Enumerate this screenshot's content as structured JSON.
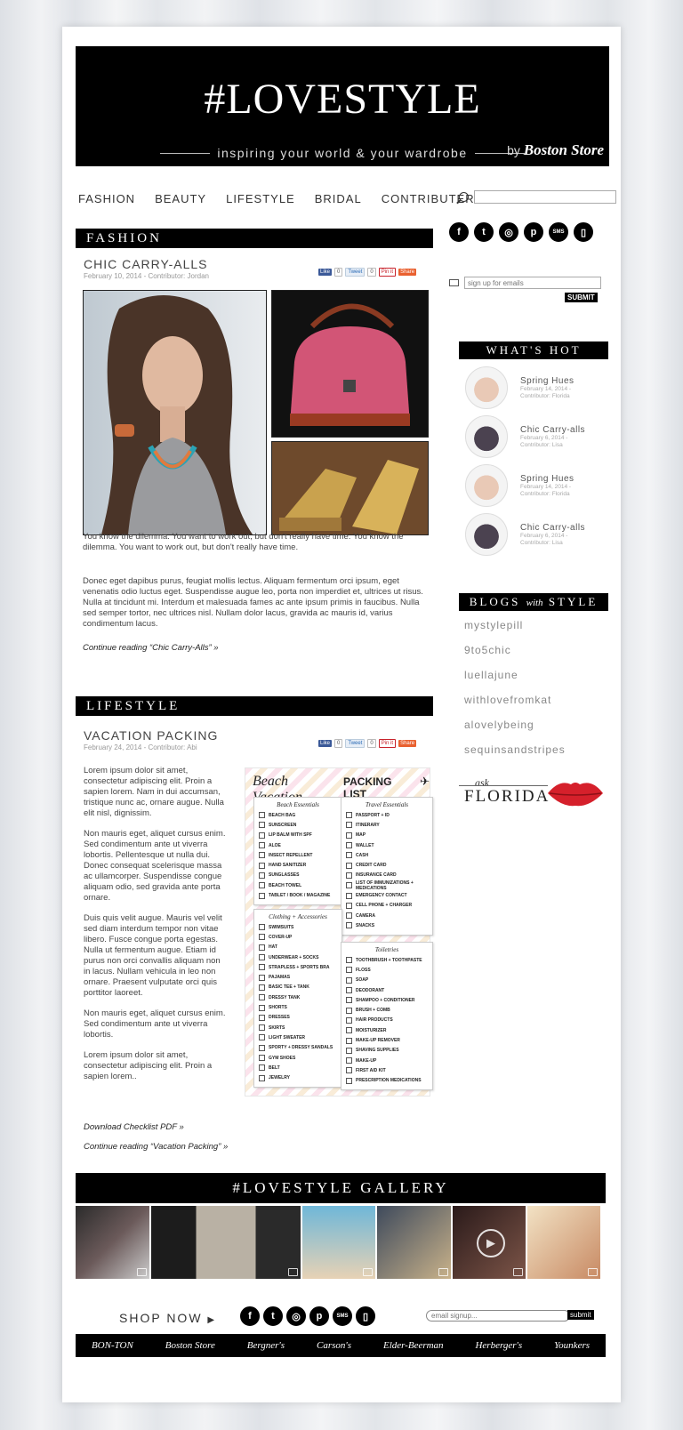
{
  "header": {
    "title": "#LOVESTYLE",
    "tagline": "inspiring your world & your wardrobe",
    "by": "by",
    "brand": "Boston Store"
  },
  "nav": {
    "items": [
      "FASHION",
      "BEAUTY",
      "LIFESTYLE",
      "BRIDAL",
      "CONTRIBUTERS"
    ],
    "search_placeholder": ""
  },
  "fashion_section": {
    "heading": "FASHION",
    "post": {
      "title": "CHIC CARRY-ALLS",
      "meta": "February 10, 2014 - Contributor: Jordan",
      "paragraph1": "You know the dilemma. You want to work out, but don't really have time. You know the dilemma. You want to work out, but don't really have time.",
      "paragraph2": "Donec eget dapibus purus, feugiat mollis lectus. Aliquam fermentum orci ipsum, eget venenatis odio luctus eget. Suspendisse augue leo, porta non imperdiet et, ultrices ut risus. Nulla at tincidunt mi. Interdum et malesuada fames ac ante ipsum primis in faucibus. Nulla sed semper tortor, nec ultrices nisl. Nullam dolor lacus, gravida ac mauris id, varius condimentum lacus.",
      "continue": "Continue reading “Chic Carry-Alls” »"
    }
  },
  "share": {
    "like": "Like",
    "like_count": "0",
    "tweet": "Tweet",
    "tweet_count": "0",
    "pin": "Pin it",
    "share": "Share"
  },
  "lifestyle_section": {
    "heading": "LIFESTYLE",
    "post": {
      "title": "VACATION PACKING",
      "meta": "February 24, 2014 - Contributor: Abi",
      "paragraphs": [
        "Lorem ipsum dolor sit amet, consectetur adipiscing elit. Proin a sapien lorem. Nam in dui accumsan, tristique nunc ac, ornare augue. Nulla elit nisl, dignissim.",
        "Non mauris eget, aliquet cursus enim. Sed condimentum ante ut viverra lobortis. Pellentesque ut nulla dui. Donec consequat scelerisque massa ac ullamcorper. Suspendisse congue aliquam odio, sed gravida ante porta ornare.",
        "Duis quis velit augue. Mauris vel velit sed diam interdum tempor non vitae libero. Fusce congue porta egestas. Nulla ut fermentum augue. Etiam id purus non orci convallis aliquam non in lacus. Nullam vehicula in leo non ornare. Praesent vulputate orci quis porttitor laoreet.",
        "Non mauris eget, aliquet cursus enim. Sed condimentum ante ut viverra lobortis.",
        "Lorem ipsum dolor sit amet, consectetur adipiscing elit. Proin a sapien lorem.."
      ],
      "download": "Download Checklist PDF »",
      "continue": "Continue reading “Vacation Packing” »"
    },
    "checklist": {
      "title_script": "Beach Vacation",
      "title_bold": "PACKING LIST",
      "groups": [
        {
          "name": "Beach Essentials",
          "items": [
            "BEACH BAG",
            "SUNSCREEN",
            "LIP BALM WITH SPF",
            "ALOE",
            "INSECT REPELLENT",
            "HAND SANITIZER",
            "SUNGLASSES",
            "BEACH TOWEL",
            "TABLET / BOOK / MAGAZINE"
          ]
        },
        {
          "name": "Travel Essentials",
          "items": [
            "PASSPORT + ID",
            "ITINERARY",
            "MAP",
            "WALLET",
            "CASH",
            "CREDIT CARD",
            "INSURANCE CARD",
            "LIST OF IMMUNIZATIONS + MEDICATIONS",
            "EMERGENCY CONTACT",
            "CELL PHONE + CHARGER",
            "CAMERA",
            "SNACKS"
          ]
        },
        {
          "name": "Clothing + Accessories",
          "items": [
            "SWIMSUITS",
            "COVER-UP",
            "HAT",
            "UNDERWEAR + SOCKS",
            "STRAPLESS + SPORTS BRA",
            "PAJAMAS",
            "BASIC TEE + TANK",
            "DRESSY TANK",
            "SHORTS",
            "DRESSES",
            "SKIRTS",
            "LIGHT SWEATER",
            "SPORTY + DRESSY SANDALS",
            "GYM SHOES",
            "BELT",
            "JEWELRY"
          ]
        },
        {
          "name": "Toiletries",
          "items": [
            "TOOTHBRUSH + TOOTHPASTE",
            "FLOSS",
            "SOAP",
            "DEODORANT",
            "SHAMPOO + CONDITIONER",
            "BRUSH + COMB",
            "HAIR PRODUCTS",
            "MOISTURIZER",
            "MAKE-UP REMOVER",
            "SHAVING SUPPLIES",
            "MAKE-UP",
            "FIRST AID KIT",
            "PRESCRIPTION MEDICATIONS"
          ]
        }
      ]
    }
  },
  "sidebar": {
    "social_icons": [
      "facebook-icon",
      "twitter-icon",
      "instagram-icon",
      "pinterest-icon",
      "sms-icon",
      "mobile-icon"
    ],
    "email_placeholder": "sign up for emails",
    "submit": "SUBMIT",
    "whats_hot": {
      "heading": "WHAT'S HOT",
      "items": [
        {
          "title": "Spring Hues",
          "date": "February 14, 2014 -",
          "contributor": "Contributor: Florida"
        },
        {
          "title": "Chic Carry-alls",
          "date": "February 6, 2014 -",
          "contributor": "Contributor: Lisa"
        },
        {
          "title": "Spring Hues",
          "date": "February 14, 2014 -",
          "contributor": "Contributor: Florida"
        },
        {
          "title": "Chic Carry-alls",
          "date": "February 6, 2014 -",
          "contributor": "Contributor: Lisa"
        }
      ]
    },
    "blogs": {
      "heading_a": "BLOGS",
      "heading_b": "with",
      "heading_c": "STYLE",
      "links": [
        "mystylepill",
        "9to5chic",
        "luellajune",
        "withlovefromkat",
        "alovelybeing",
        "sequinsandstripes"
      ]
    },
    "ask": {
      "small": "ask",
      "name": "FLORIDA"
    }
  },
  "gallery": {
    "heading": "#LOVESTYLE GALLERY"
  },
  "footer": {
    "shop_now": "SHOP NOW",
    "email_placeholder": "email signup...",
    "submit": "submit",
    "brands": [
      "BON-TON",
      "Boston Store",
      "Bergner's",
      "Carson's",
      "Elder-Beerman",
      "Herberger's",
      "Younkers"
    ]
  },
  "colors": {
    "black": "#000000",
    "pin_red": "#c8232c",
    "facebook": "#3b5998",
    "share_orange": "#e9602f"
  }
}
